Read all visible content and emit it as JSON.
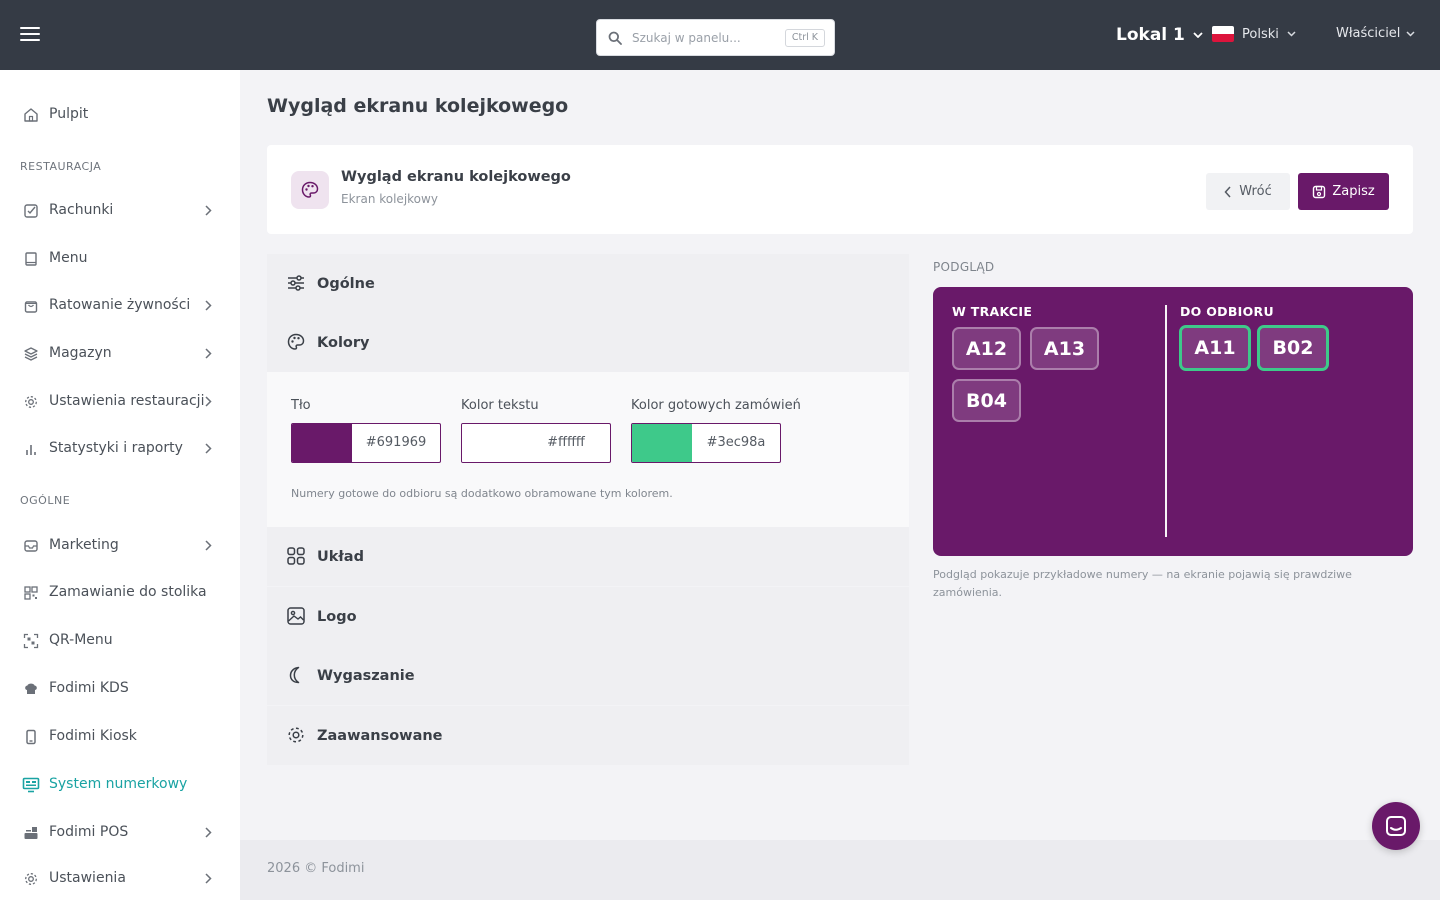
{
  "topbar": {
    "search_placeholder": "Szukaj w panelu...",
    "search_shortcut": "Ctrl K",
    "location": "Lokal 1",
    "language": "Polski",
    "user": "Właściciel"
  },
  "sidebar": {
    "dashboard": "Pulpit",
    "section_restaurant": "RESTAURACJA",
    "section_general": "OGÓLNE",
    "items": [
      {
        "label": "Rachunki"
      },
      {
        "label": "Menu"
      },
      {
        "label": "Ratowanie żywności"
      },
      {
        "label": "Magazyn"
      },
      {
        "label": "Ustawienia restauracji"
      },
      {
        "label": "Statystyki i raporty"
      },
      {
        "label": "Marketing"
      },
      {
        "label": "Zamawianie do stolika"
      },
      {
        "label": "QR-Menu"
      },
      {
        "label": "Fodimi KDS"
      },
      {
        "label": "Fodimi Kiosk"
      },
      {
        "label": "System numerkowy"
      },
      {
        "label": "Fodimi POS"
      },
      {
        "label": "Ustawienia"
      }
    ]
  },
  "page": {
    "title": "Wygląd ekranu kolejkowego",
    "card_title": "Wygląd ekranu kolejkowego",
    "card_subtitle": "Ekran kolejkowy",
    "back_label": "Wróć",
    "save_label": "Zapisz"
  },
  "sections": {
    "general": "Ogólne",
    "colors": "Kolory",
    "layout": "Układ",
    "logo": "Logo",
    "screensaver": "Wygaszanie",
    "advanced": "Zaawansowane"
  },
  "colors": {
    "background_label": "Tło",
    "background_value": "#691969",
    "text_label": "Kolor tekstu",
    "text_value": "#ffffff",
    "ready_label": "Kolor gotowych zamówień",
    "ready_value": "#3ec98a",
    "hint": "Numery gotowe do odbioru są dodatkowo obramowane tym kolorem."
  },
  "preview": {
    "label": "PODGLĄD",
    "in_progress_title": "W TRAKCIE",
    "ready_title": "DO ODBIORU",
    "in_progress": [
      "A12",
      "A13",
      "B04"
    ],
    "ready": [
      "A11",
      "B02"
    ],
    "note": "Podgląd pokazuje przykładowe numery — na ekranie pojawią się prawdziwe zamówienia."
  },
  "footer": "2026 © Fodimi"
}
